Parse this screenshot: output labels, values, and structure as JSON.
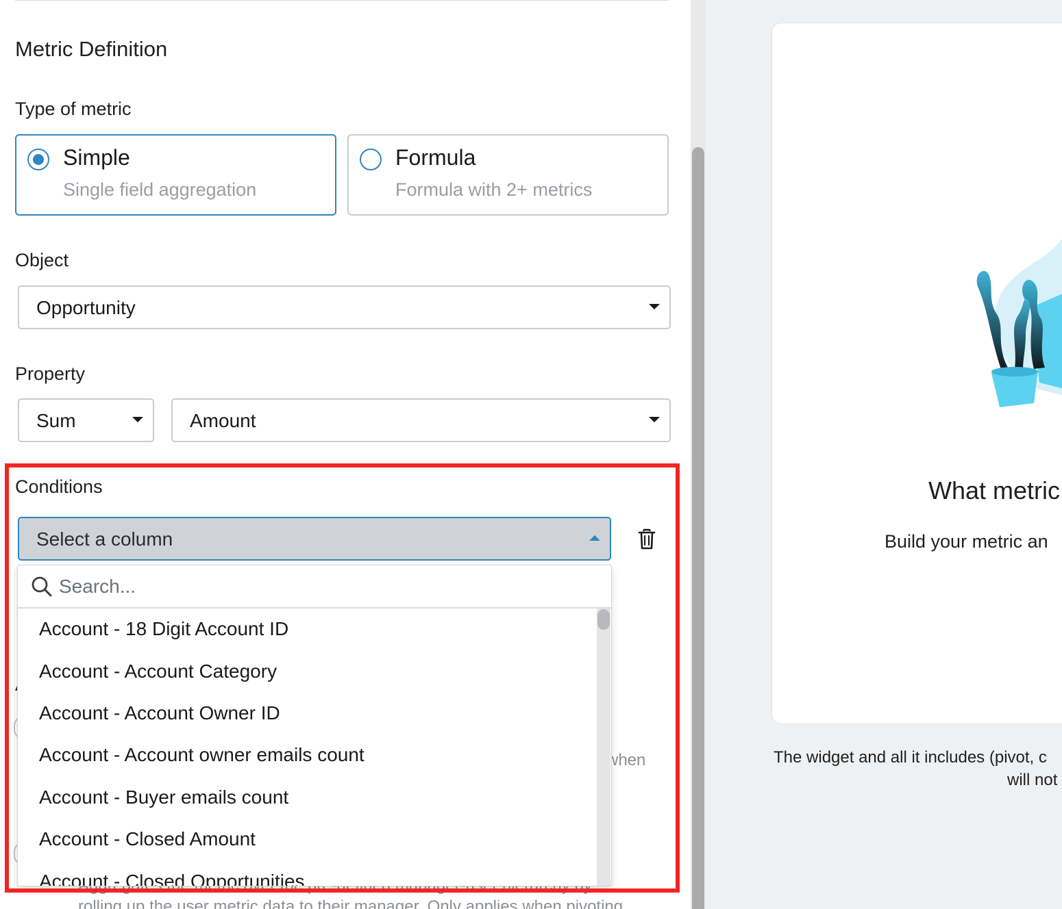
{
  "metric_definition": {
    "section_title": "Metric Definition",
    "type_label": "Type of metric",
    "types": [
      {
        "title": "Simple",
        "subtitle": "Single field aggregation",
        "selected": true
      },
      {
        "title": "Formula",
        "subtitle": "Formula with 2+ metrics",
        "selected": false
      }
    ],
    "object_label": "Object",
    "object_value": "Opportunity",
    "property_label": "Property",
    "aggregation_value": "Sum",
    "field_value": "Amount"
  },
  "conditions": {
    "label": "Conditions",
    "column_select_placeholder": "Select a column",
    "search_placeholder": "Search...",
    "options": [
      "Account - 18 Digit Account ID",
      "Account - Account Category",
      "Account - Account Owner ID",
      "Account - Account owner emails count",
      "Account - Buyer emails count",
      "Account - Closed Amount",
      "Account - Closed Opportunities"
    ]
  },
  "background_fragments": {
    "hidden_label_fragment": "A",
    "when_fragment": "when",
    "rollup_line1": "Aggregates the metric over the pre-defined manager-user hierarchy by",
    "rollup_line2": "rolling up the user metric data to their manager. Only applies when pivoting"
  },
  "preview": {
    "empty_title": "What metric",
    "empty_subtitle": "Build your metric an",
    "footnote_line1": "The widget and all it includes (pivot, c",
    "footnote_line2": "will not"
  },
  "colors": {
    "accent": "#2f86c0",
    "highlight": "#f52323",
    "select_active_bg": "#cfd3d8",
    "panel_bg": "#eef0f2",
    "muted_text": "#9a9da3"
  },
  "icons": {
    "type_selected": "radio-checked-icon",
    "type_unselected": "radio-unchecked-icon",
    "dropdown": "chevron-down-icon",
    "dropdown_open": "chevron-up-icon",
    "delete": "trash-icon",
    "search": "search-icon",
    "illustration": "plant-illustration"
  }
}
